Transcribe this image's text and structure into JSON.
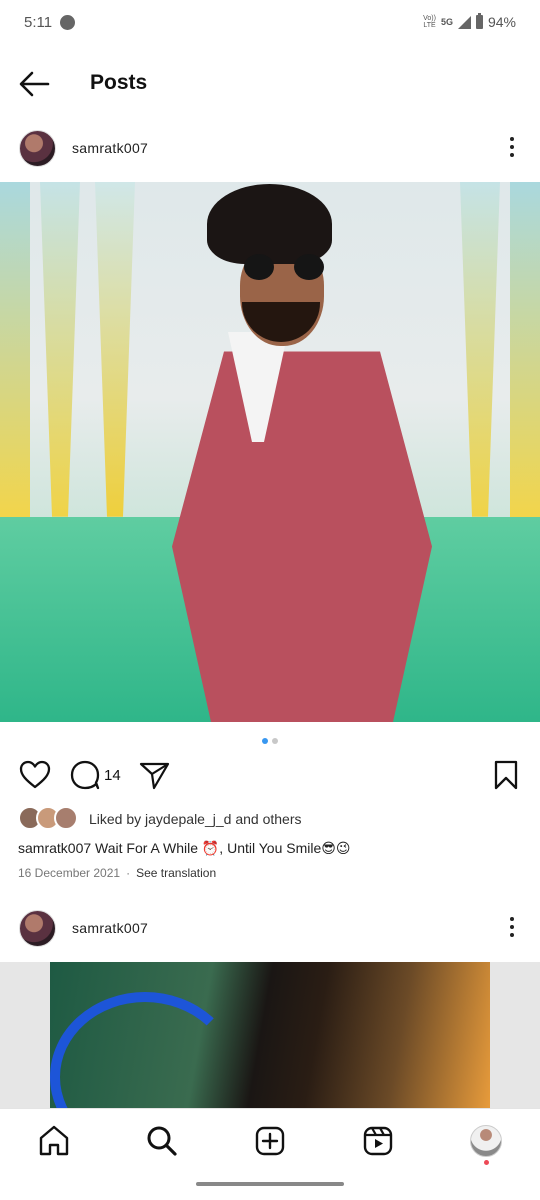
{
  "status_bar": {
    "time": "5:11",
    "volte_top": "Vo))",
    "volte_bottom": "LTE",
    "network": "5G",
    "battery": "94%"
  },
  "header": {
    "title": "Posts"
  },
  "posts": [
    {
      "username": "samratk007",
      "image_count": 2,
      "active_image_index": 0,
      "comment_count": "14",
      "liked_by_text": "Liked by jaydepale_j_d and others",
      "caption": "samratk007 Wait For A While ⏰, Until You Smile😎😉",
      "date": "16 December 2021",
      "separator": "·",
      "see_translation": "See translation"
    },
    {
      "username": "samratk007"
    }
  ],
  "colors": {
    "accent": "#3897f0",
    "notification": "#ed4956",
    "text_primary": "#111111",
    "text_secondary": "#777777"
  },
  "icons": {
    "back": "arrow-left-icon",
    "more": "more-vertical-icon",
    "like": "heart-icon",
    "comment": "comment-icon",
    "share": "send-icon",
    "save": "bookmark-icon",
    "home": "home-icon",
    "search": "search-icon",
    "create": "plus-square-icon",
    "reels": "reels-icon"
  }
}
